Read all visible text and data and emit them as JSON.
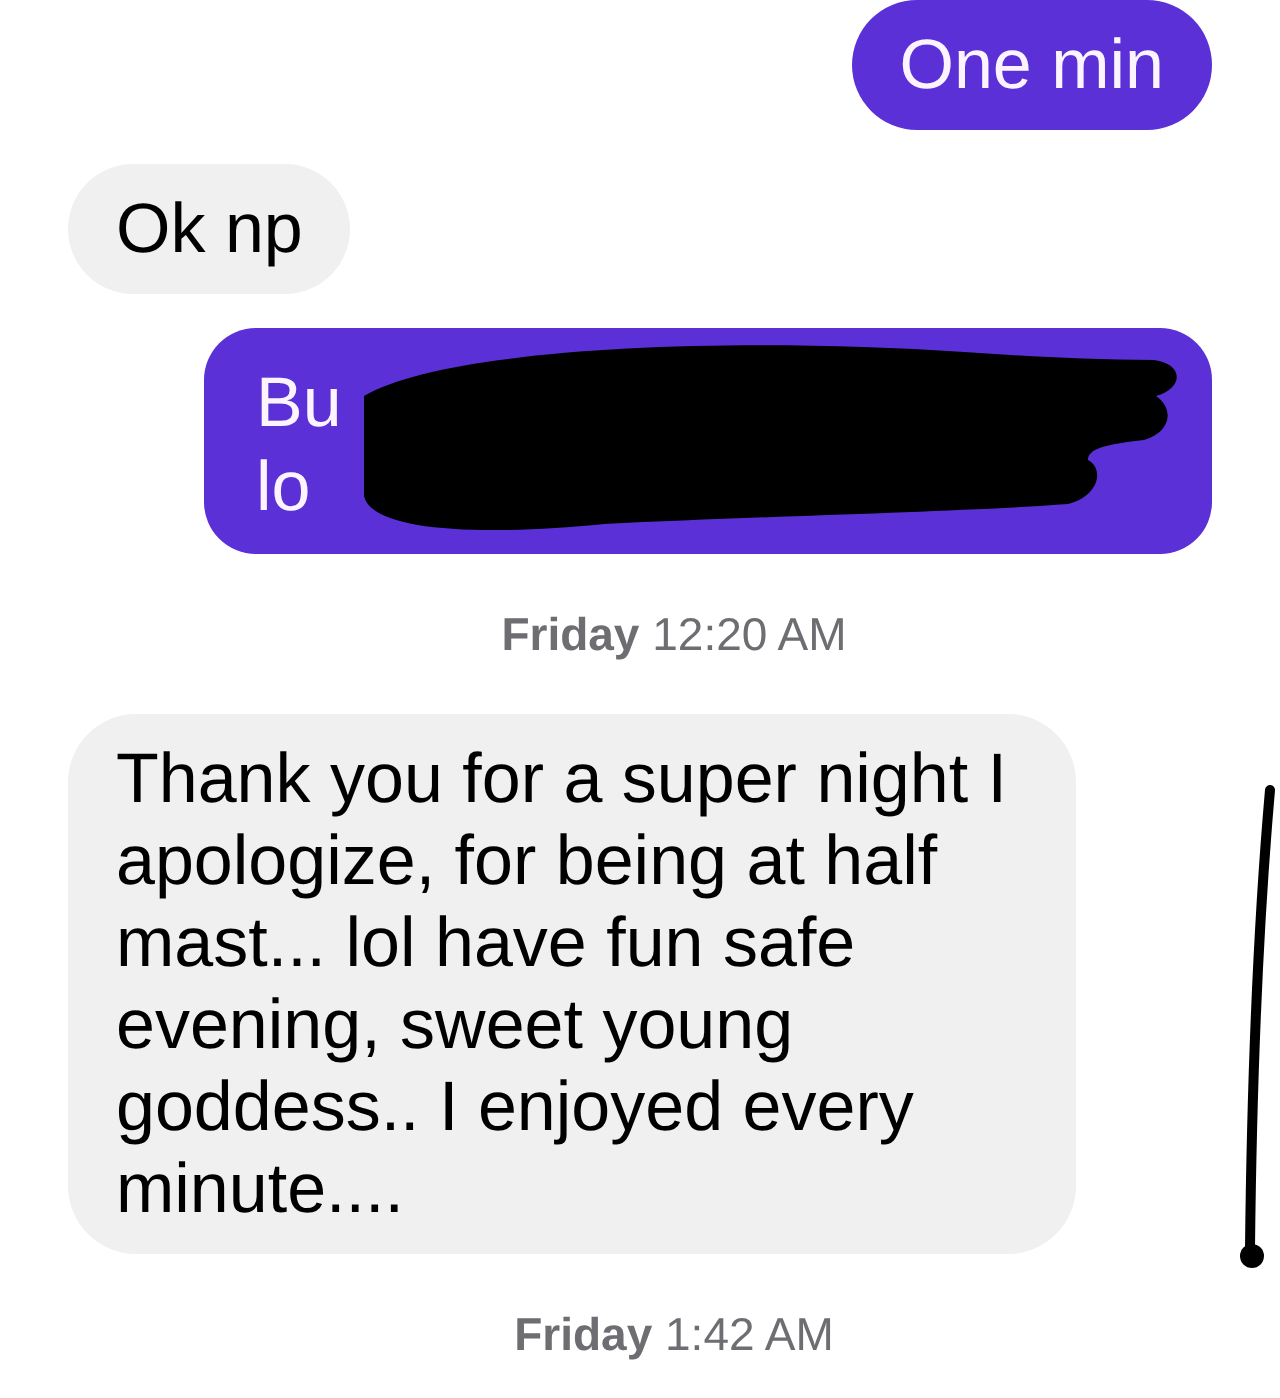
{
  "conversation": [
    {
      "kind": "message",
      "outgoing": true,
      "text": "One min"
    },
    {
      "kind": "message",
      "outgoing": false,
      "text": "Ok np"
    },
    {
      "kind": "redacted_message",
      "outgoing": true,
      "visible_fragments": [
        "Bu",
        "lo"
      ]
    },
    {
      "kind": "timestamp",
      "text": "**Friday** 12:20 AM"
    },
    {
      "kind": "message",
      "outgoing": false,
      "text": "Thank you for a super night I apologize, for being at half mast... lol have fun safe evening, sweet young goddess.. I enjoyed every minute...."
    },
    {
      "kind": "timestamp",
      "text": "**Friday** 1:42 AM"
    }
  ]
}
